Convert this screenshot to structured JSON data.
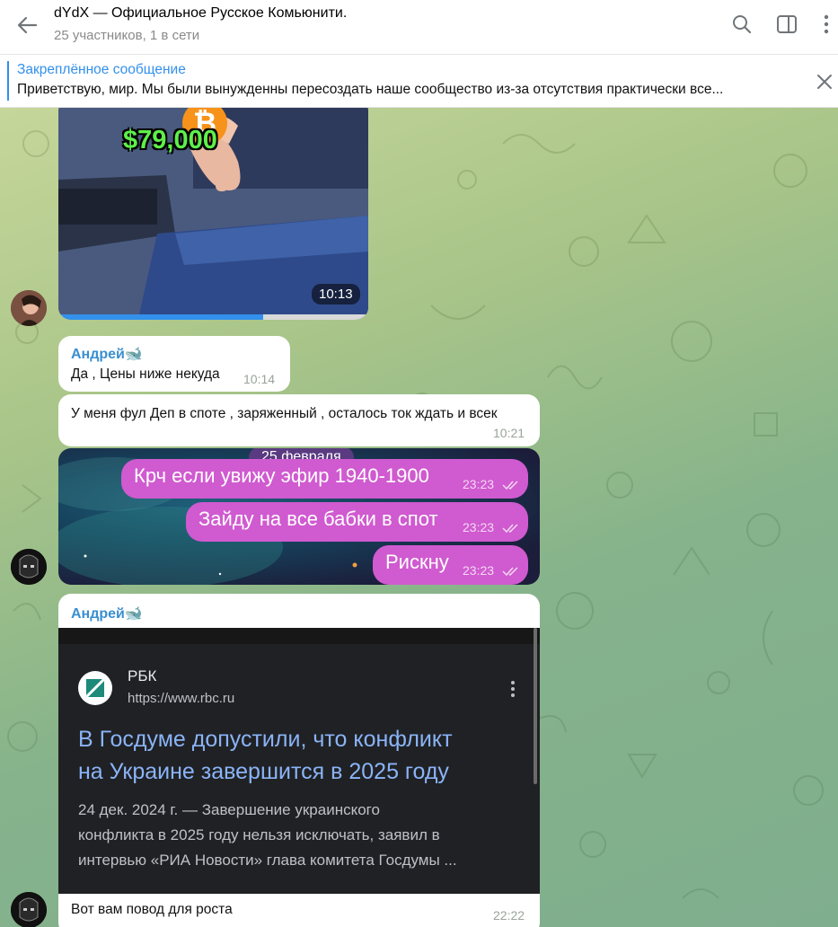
{
  "header": {
    "title": "dYdX — Официальное Русское Комьюнити.",
    "subtitle": "25 участников, 1 в сети"
  },
  "pinned": {
    "title": "Закреплённое сообщение",
    "text": "Приветствую, мир. Мы были вынужденны пересоздать наше сообщество из-за отсутствия практически все..."
  },
  "messages": {
    "video": {
      "price_overlay": "$79,000",
      "time": "10:13",
      "progress": 0.66
    },
    "m1": {
      "sender": "Андрей🐋",
      "text": "Да , Цены ниже некуда",
      "time": "10:14"
    },
    "m2": {
      "text": "У меня фул Деп в споте , заряженный , осталось ток ждать и всек",
      "time": "10:21"
    },
    "screenshot": {
      "date_pill": "25 февраля",
      "lines": [
        {
          "text": "Крч если увижу эфир 1940-1900",
          "time": "23:23"
        },
        {
          "text": "Зайду на все бабки в спот",
          "time": "23:23"
        },
        {
          "text": "Рискну",
          "time": "23:23"
        }
      ]
    },
    "m3": {
      "sender": "Андрей🐋",
      "card": {
        "source": "РБК",
        "url": "https://www.rbc.ru",
        "headline_1": "В Госдуме допустили, что конфликт",
        "headline_2": "на Украине завершится в 2025 году",
        "snippet_1": "24 дек. 2024 г. — Завершение украинского",
        "snippet_2": "конфликта в 2025 году нельзя исключать, заявил в",
        "snippet_3": "интервью «РИА Новости» глава комитета Госдумы ..."
      },
      "text": "Вот вам повод для роста",
      "time": "22:22"
    }
  },
  "colors": {
    "accent": "#3390ec",
    "sender": "#3a8fd0",
    "bubble_pink": "#d05ad0",
    "card_bg": "#202124",
    "link_blue": "#8ab4f8"
  }
}
